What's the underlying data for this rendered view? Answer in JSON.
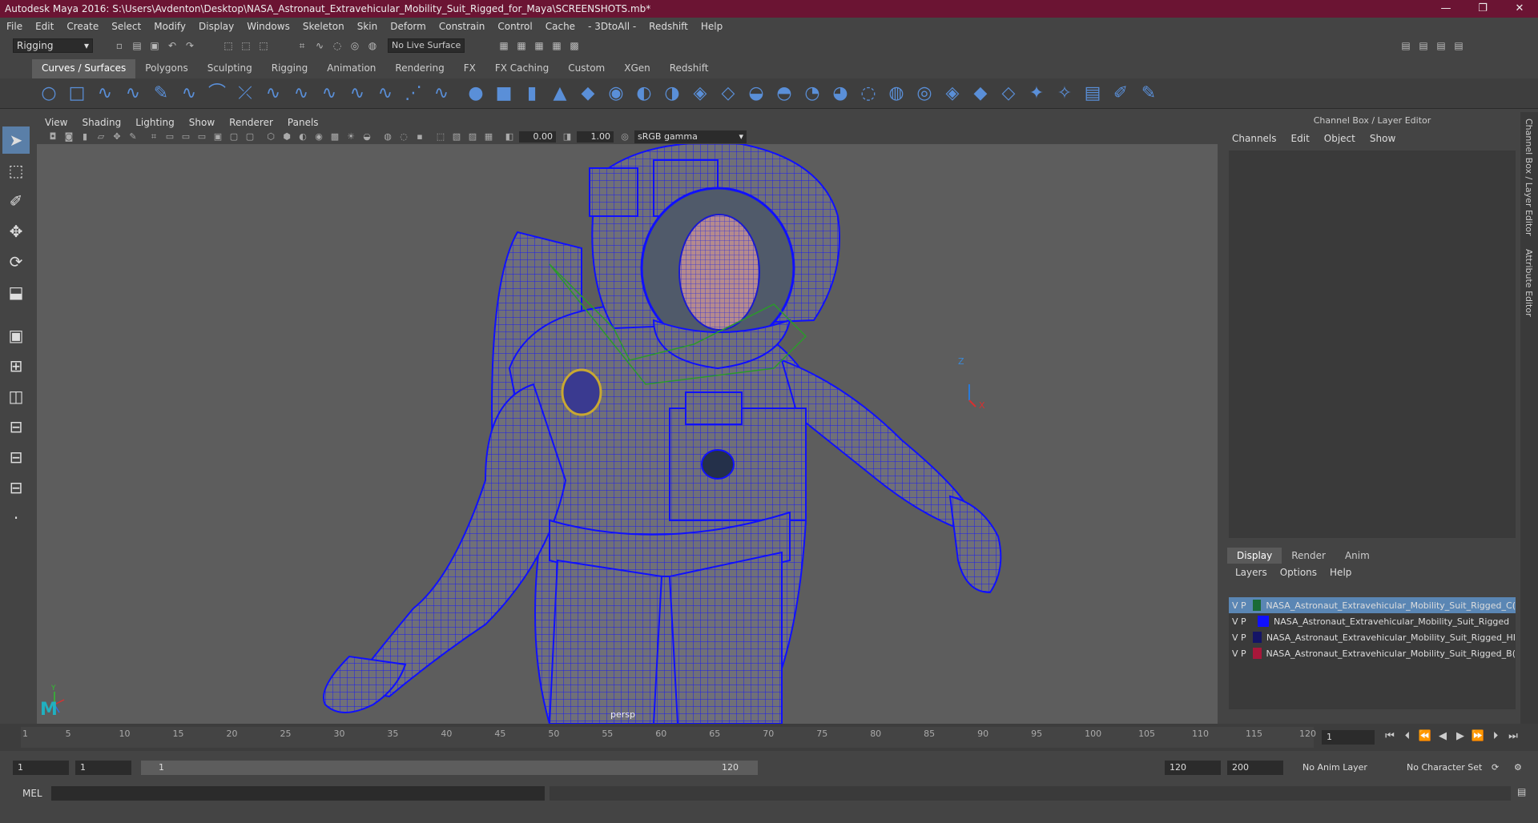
{
  "window": {
    "title": "Autodesk Maya 2016: S:\\Users\\Avdenton\\Desktop\\NASA_Astronaut_Extravehicular_Mobility_Suit_Rigged_for_Maya\\SCREENSHOTS.mb*",
    "minimize": "—",
    "restore": "❐",
    "close": "✕"
  },
  "menubar": [
    "File",
    "Edit",
    "Create",
    "Select",
    "Modify",
    "Display",
    "Windows",
    "Skeleton",
    "Skin",
    "Deform",
    "Constrain",
    "Control",
    "Cache",
    "- 3DtoAll -",
    "Redshift",
    "Help"
  ],
  "toolbar": {
    "mode": "Rigging",
    "live_surface": "No Live Surface"
  },
  "shelf_tabs": [
    {
      "label": "Curves / Surfaces",
      "active": true
    },
    {
      "label": "Polygons",
      "active": false
    },
    {
      "label": "Sculpting",
      "active": false
    },
    {
      "label": "Rigging",
      "active": false
    },
    {
      "label": "Animation",
      "active": false
    },
    {
      "label": "Rendering",
      "active": false
    },
    {
      "label": "FX",
      "active": false
    },
    {
      "label": "FX Caching",
      "active": false
    },
    {
      "label": "Custom",
      "active": false
    },
    {
      "label": "XGen",
      "active": false
    },
    {
      "label": "Redshift",
      "active": false
    }
  ],
  "viewport": {
    "menus": [
      "View",
      "Shading",
      "Lighting",
      "Show",
      "Renderer",
      "Panels"
    ],
    "exposure": "0.00",
    "gamma_value": "1.00",
    "color_space": "sRGB gamma",
    "camera_label": "persp",
    "axis_labels": {
      "z": "Z",
      "x": "X",
      "y": "Y"
    }
  },
  "right_panel": {
    "title": "Channel Box / Layer Editor",
    "channel_menus": [
      "Channels",
      "Edit",
      "Object",
      "Show"
    ],
    "layer_tabs": [
      {
        "label": "Display",
        "active": true
      },
      {
        "label": "Render",
        "active": false
      },
      {
        "label": "Anim",
        "active": false
      }
    ],
    "layer_menus": [
      "Layers",
      "Options",
      "Help"
    ],
    "layers": [
      {
        "v": "V",
        "p": "P",
        "name": "NASA_Astronaut_Extravehicular_Mobility_Suit_Rigged_C(",
        "color": "#1a6b35",
        "selected": true
      },
      {
        "v": "V",
        "p": "P",
        "name": "NASA_Astronaut_Extravehicular_Mobility_Suit_Rigged",
        "color": "#1010ff",
        "selected": false
      },
      {
        "v": "V",
        "p": "P",
        "name": "NASA_Astronaut_Extravehicular_Mobility_Suit_Rigged_HI",
        "color": "#141466",
        "selected": false
      },
      {
        "v": "V",
        "p": "P",
        "name": "NASA_Astronaut_Extravehicular_Mobility_Suit_Rigged_B(",
        "color": "#a8173a",
        "selected": false
      }
    ],
    "side_tabs": [
      "Channel Box / Layer Editor",
      "Attribute Editor"
    ]
  },
  "timeline": {
    "ticks": [
      "1",
      "5",
      "10",
      "15",
      "20",
      "25",
      "30",
      "35",
      "40",
      "45",
      "50",
      "55",
      "60",
      "65",
      "70",
      "75",
      "80",
      "85",
      "90",
      "95",
      "100",
      "105",
      "110",
      "115",
      "120"
    ],
    "current_frame": "1"
  },
  "range": {
    "start": "1",
    "playback_start": "1",
    "slider_start": "1",
    "slider_end": "120",
    "playback_end": "120",
    "end": "200",
    "anim_layer": "No Anim Layer",
    "character_set": "No Character Set"
  },
  "cmd": {
    "label": "MEL"
  }
}
